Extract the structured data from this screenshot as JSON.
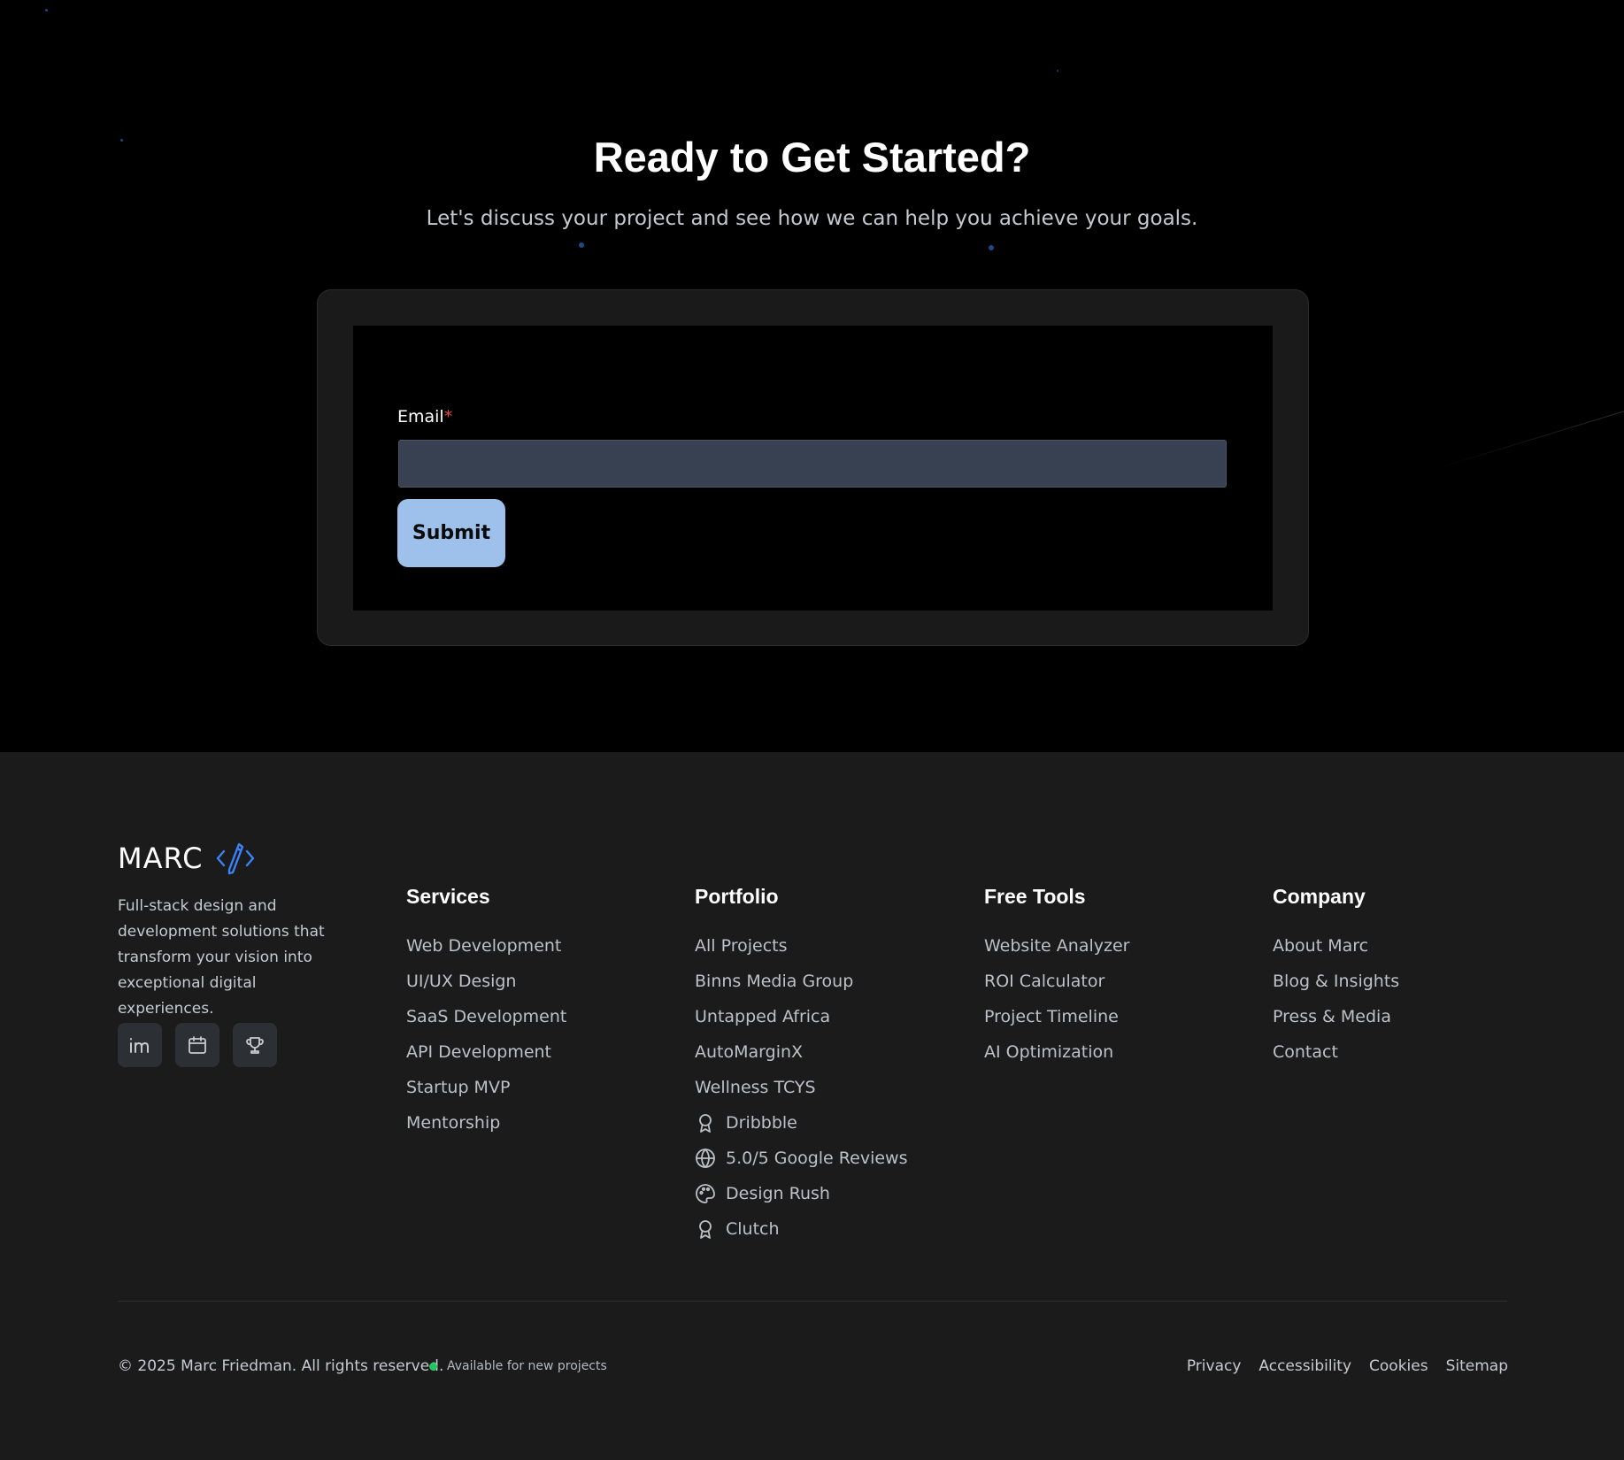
{
  "cta": {
    "title": "Ready to Get Started?",
    "subtitle": "Let's discuss your project and see how we can help you achieve your goals.",
    "email_label": "Email",
    "required_mark": "*",
    "email_value": "",
    "submit_label": "Submit"
  },
  "footer": {
    "logo_text": "MARC",
    "tagline": "Full-stack design and development solutions that transform your vision into exceptional digital experiences.",
    "socials": [
      {
        "icon": "linkedin-icon"
      },
      {
        "icon": "calendar-icon"
      },
      {
        "icon": "trophy-icon"
      }
    ],
    "services": {
      "heading": "Services",
      "items": [
        "Web Development",
        "UI/UX Design",
        "SaaS Development",
        "API Development",
        "Startup MVP",
        "Mentorship"
      ]
    },
    "portfolio": {
      "heading": "Portfolio",
      "items": [
        "All Projects",
        "Binns Media Group",
        "Untapped Africa",
        "AutoMarginX",
        "Wellness TCYS"
      ],
      "badges": [
        {
          "icon": "award-icon",
          "label": "Dribbble"
        },
        {
          "icon": "globe-icon",
          "label": "5.0/5 Google Reviews"
        },
        {
          "icon": "palette-icon",
          "label": "Design Rush"
        },
        {
          "icon": "award-icon",
          "label": "Clutch"
        }
      ]
    },
    "tools": {
      "heading": "Free Tools",
      "items": [
        "Website Analyzer",
        "ROI Calculator",
        "Project Timeline",
        "AI Optimization"
      ]
    },
    "company": {
      "heading": "Company",
      "items": [
        "About Marc",
        "Blog & Insights",
        "Press & Media",
        "Contact"
      ]
    },
    "copyright": "© 2025 Marc Friedman. All rights reserved.",
    "status": "Available for new projects",
    "status_color": "#22c55e",
    "legal": [
      "Privacy",
      "Accessibility",
      "Cookies",
      "Sitemap"
    ]
  },
  "colors": {
    "accent_button": "#9dc1ea",
    "footer_bg": "#1b1b1b",
    "input_bg": "#374151",
    "logo_accent": "#3b82f6"
  }
}
